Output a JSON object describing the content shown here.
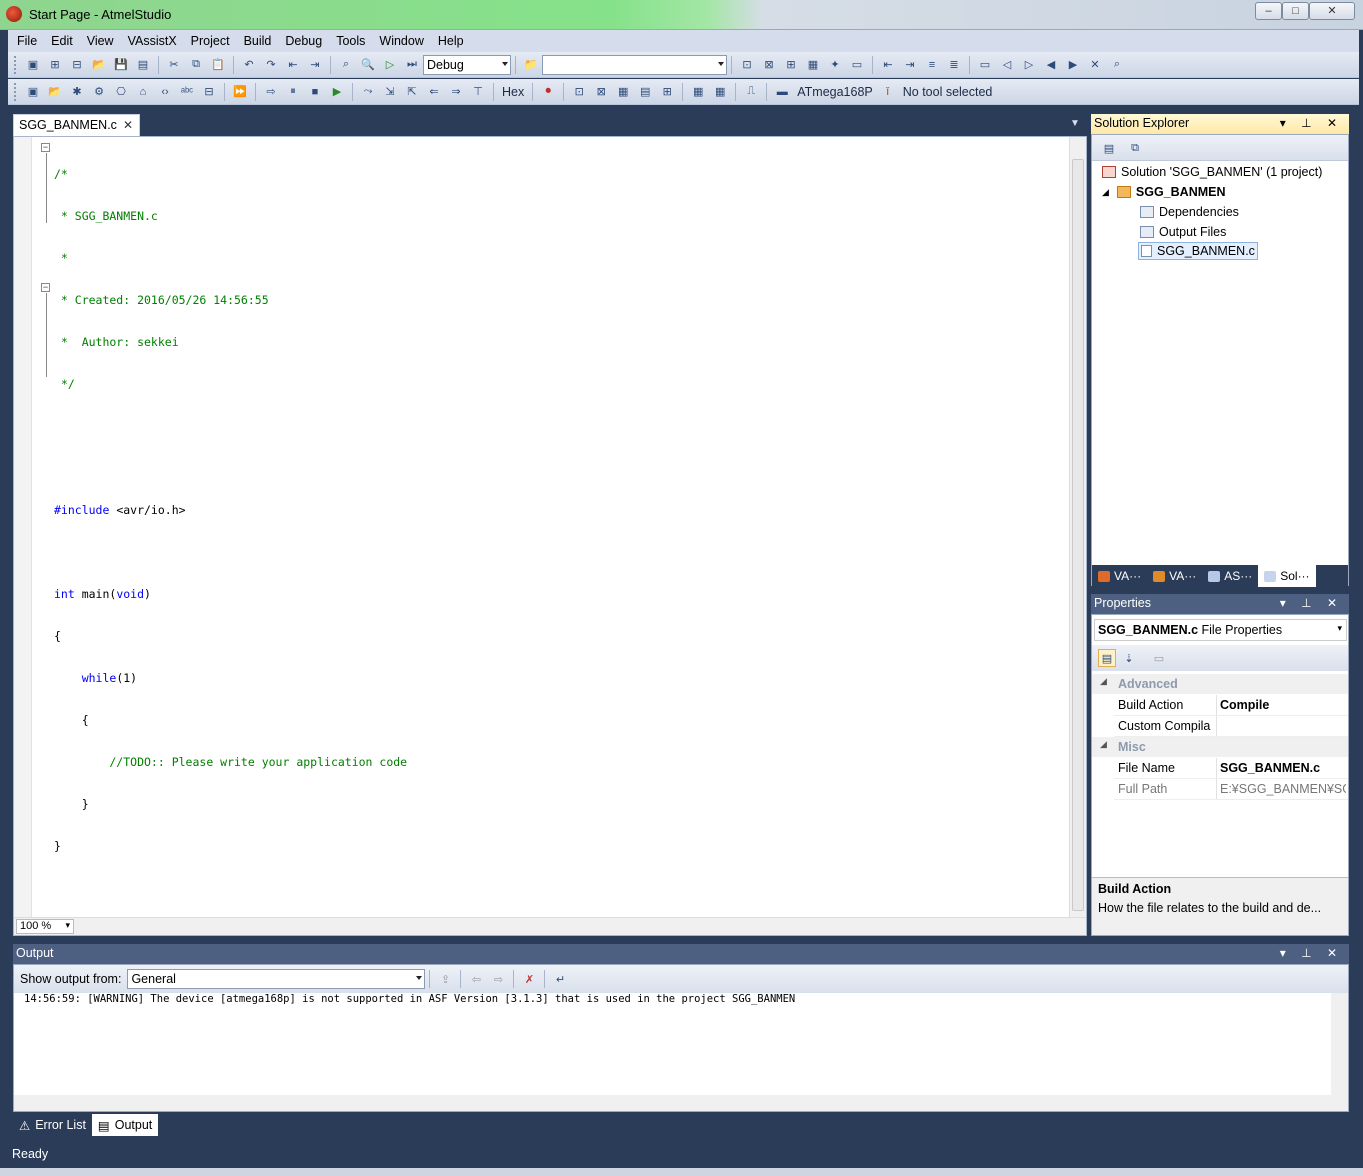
{
  "window": {
    "title": "Start Page - AtmelStudio",
    "minimize_label": "–",
    "maximize_label": "□",
    "close_label": "✕"
  },
  "menu": [
    "File",
    "Edit",
    "View",
    "VAssistX",
    "Project",
    "Build",
    "Debug",
    "Tools",
    "Window",
    "Help"
  ],
  "toolbar1": {
    "configuration": "Debug",
    "platform": ""
  },
  "toolbar2": {
    "hex_label": "Hex",
    "device": "ATmega168P",
    "tool": "No tool selected"
  },
  "editor": {
    "tab_label": "SGG_BANMEN.c",
    "zoom": "100 %",
    "code_lines": [
      "/*",
      " * SGG_BANMEN.c",
      " *",
      " * Created: 2016/05/26 14:56:55",
      " *  Author: sekkei",
      " */",
      "",
      "",
      "#include <avr/io.h>",
      "",
      "int main(void)",
      "{",
      "    while(1)",
      "    {",
      "        //TODO:: Please write your application code",
      "    }",
      "}"
    ]
  },
  "solution_explorer": {
    "title": "Solution Explorer",
    "solution": "Solution 'SGG_BANMEN' (1 project)",
    "project": "SGG_BANMEN",
    "items": [
      "Dependencies",
      "Output Files",
      "SGG_BANMEN.c"
    ],
    "tabs": [
      "VA···",
      "VA···",
      "AS···",
      "Sol···"
    ]
  },
  "properties": {
    "title": "Properties",
    "object_name": "SGG_BANMEN.c",
    "object_type": "File Properties",
    "categories": [
      "Advanced",
      "Misc"
    ],
    "rows": [
      {
        "key": "Build Action",
        "value": "Compile"
      },
      {
        "key": "Custom Compila",
        "value": ""
      },
      {
        "key": "File Name",
        "value": "SGG_BANMEN.c"
      },
      {
        "key": "Full Path",
        "value": "E:¥SGG_BANMEN¥SG"
      }
    ],
    "description_title": "Build Action",
    "description_text": "How the file relates to the build and de..."
  },
  "output": {
    "title": "Output",
    "show_from_label": "Show output from:",
    "source": "General",
    "text": "14:56:59: [WARNING] The device [atmega168p] is not supported in ASF Version [3.1.3] that is used in the project SGG_BANMEN"
  },
  "bottom_tabs": [
    "Error List",
    "Output"
  ],
  "status": "Ready",
  "colors": {
    "chrome": "#2b3c59",
    "active_header": "#ffe8a6",
    "comment": "#008000",
    "keyword": "#0000ff"
  }
}
